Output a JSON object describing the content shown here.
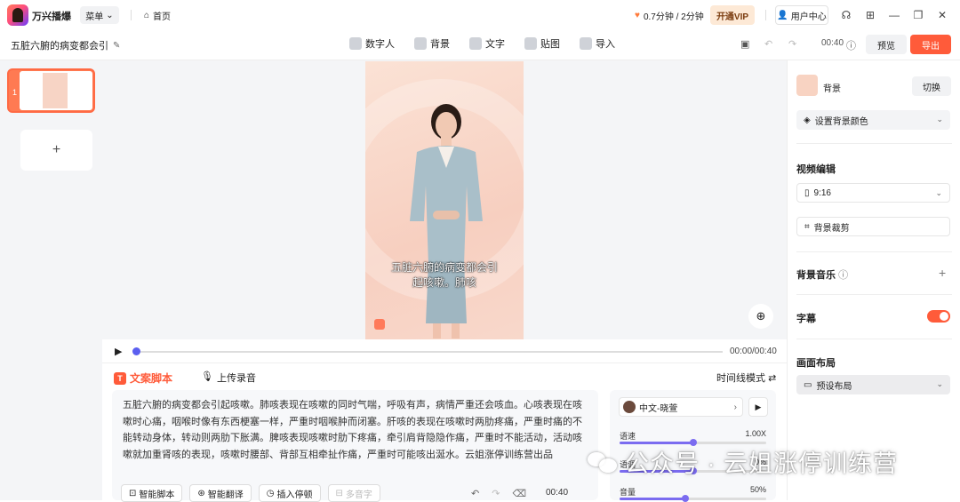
{
  "app": {
    "name": "万兴播爆",
    "menu_label": "菜单",
    "home_label": "首页",
    "quota": "0.7分钟 / 2分钟",
    "vip_label": "开通VIP",
    "user_label": "用户中心"
  },
  "project": {
    "title": "五脏六腑的病变都会引"
  },
  "toolbar": {
    "items": [
      {
        "label": "数字人"
      },
      {
        "label": "背景"
      },
      {
        "label": "文字"
      },
      {
        "label": "贴图"
      },
      {
        "label": "导入"
      }
    ],
    "duration": "00:40",
    "preview_label": "预览",
    "export_label": "导出"
  },
  "slides": {
    "items": [
      {
        "number": "1"
      }
    ]
  },
  "video": {
    "caption_line1": "五脏六腑的病变都会引",
    "caption_line2": "起咳嗽。肺咳"
  },
  "player": {
    "time": "00:00/00:40"
  },
  "script": {
    "tab_script": "文案脚本",
    "tab_record": "上传录音",
    "mode_label": "时间线模式",
    "text": "五脏六腑的病变都会引起咳嗽。肺咳表现在咳嗽的同时气喘，呼吸有声，病情严重还会咳血。心咳表现在咳嗽时心痛，咽喉时像有东西梗塞一样，严重时咽喉肿而闭塞。肝咳的表现在咳嗽时两肋疼痛，严重时痛的不能转动身体，转动则两肋下胀满。脾咳表现咳嗽时肋下疼痛，牵引肩背隐隐作痛，严重时不能活动，活动咳嗽就加重肾咳的表现，咳嗽时腰部、背部互相牵扯作痛，严重时可能咳出涎水。云姐涨停训练营出品",
    "buttons": {
      "smart_script": "智能脚本",
      "smart_translate": "智能翻译",
      "insert_pause": "插入停顿",
      "polyphone": "多音字"
    },
    "duration": "00:40"
  },
  "voice": {
    "name": "中文-晓萱",
    "speed": {
      "label": "语速",
      "value": "1.00X",
      "fraction": 0.5
    },
    "pitch": {
      "label": "语调",
      "value": "0%",
      "fraction": 0.5
    },
    "volume": {
      "label": "音量",
      "value": "50%",
      "fraction": 0.45
    }
  },
  "right": {
    "bg_label": "背景",
    "switch_label": "切换",
    "bg_color_label": "设置背景颜色",
    "video_edit_title": "视频编辑",
    "ratio": "9:16",
    "bg_crop": "背景裁剪",
    "music_title": "背景音乐",
    "subtitle_title": "字幕",
    "subtitle_on": true,
    "layout_title": "画面布局",
    "layout_value": "预设布局"
  },
  "watermark": {
    "text": "公众号 · 云姐涨停训练营"
  },
  "colors": {
    "accent": "#ff5b3a",
    "slider": "#7b6cf0",
    "vip_bg": "#fde9d6"
  }
}
